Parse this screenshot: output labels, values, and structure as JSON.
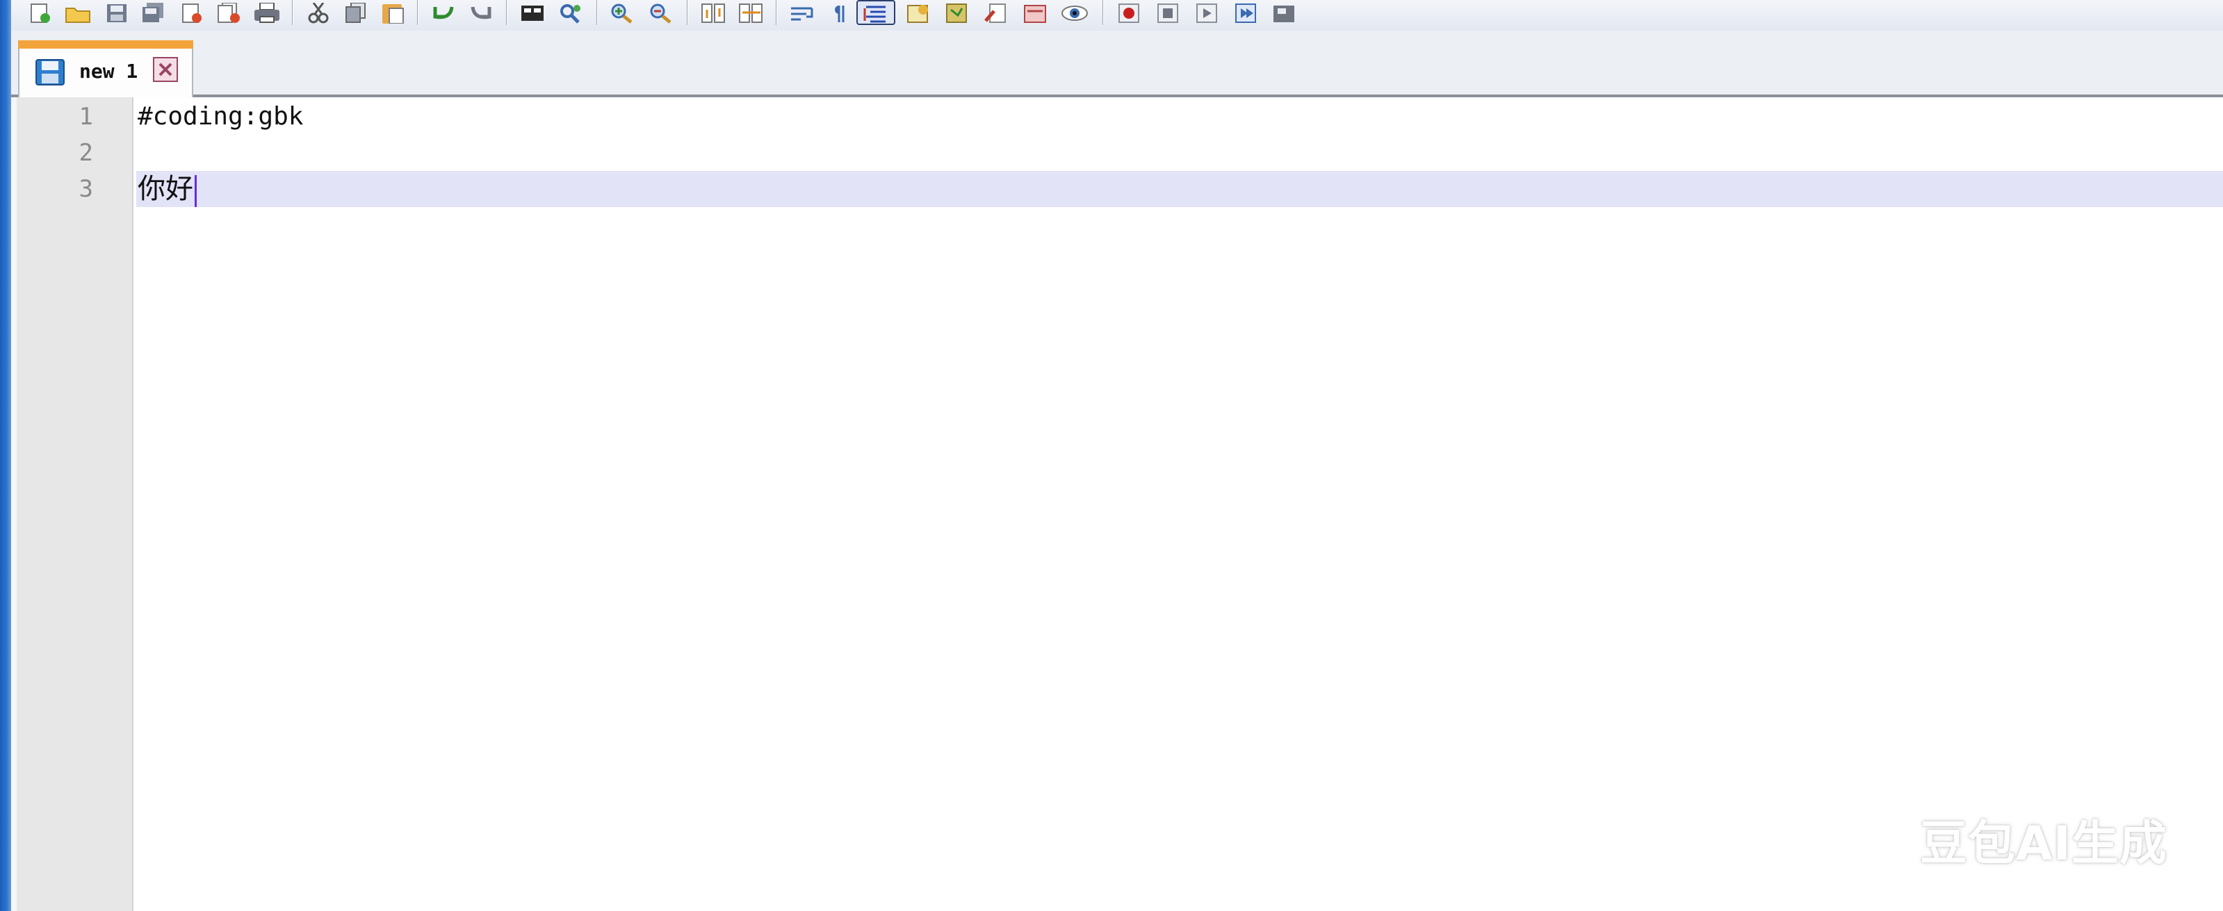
{
  "tab": {
    "label": "new 1",
    "accent_color": "#f2a43a"
  },
  "toolbar": {
    "icons": [
      "new-file-icon",
      "open-file-icon",
      "save-icon",
      "save-all-icon",
      "close-icon",
      "close-all-icon",
      "print-icon",
      "cut-icon",
      "copy-icon",
      "paste-icon",
      "undo-icon",
      "redo-icon",
      "find-icon",
      "replace-icon",
      "zoom-in-icon",
      "zoom-out-icon",
      "sync-vertical-icon",
      "sync-horizontal-icon",
      "word-wrap-icon",
      "show-all-chars-icon",
      "indent-guide-icon",
      "user-language-icon",
      "doc-map-icon",
      "function-list-icon",
      "folder-workspace-icon",
      "monitoring-icon",
      "record-macro-icon",
      "stop-macro-icon",
      "play-macro-icon",
      "run-macro-icon",
      "save-macro-icon"
    ]
  },
  "editor": {
    "lines": [
      {
        "number": "1",
        "text": "#coding:gbk"
      },
      {
        "number": "2",
        "text": ""
      },
      {
        "number": "3",
        "text": "你好"
      }
    ],
    "current_line_color": "#e2e3f7"
  },
  "watermark": {
    "text": "豆包AI生成"
  }
}
